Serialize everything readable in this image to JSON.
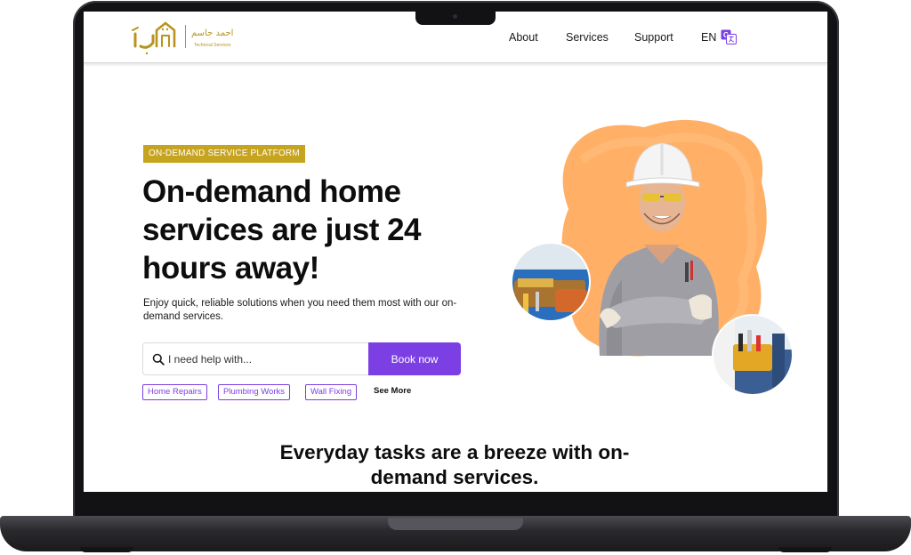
{
  "nav": {
    "logo": {
      "arabic_name": "احمد جاسم",
      "subtitle": "Technical Services"
    },
    "links": [
      {
        "label": "About"
      },
      {
        "label": "Services"
      },
      {
        "label": "Support"
      }
    ],
    "language": "EN"
  },
  "hero": {
    "badge": "ON-DEMAND SERVICE PLATFORM",
    "title": "On-demand home services are just 24 hours away!",
    "subtitle": "Enjoy quick, reliable solutions when you need them most with our on-demand services.",
    "search": {
      "placeholder": "I need help with...",
      "button": "Book now"
    },
    "tags": [
      {
        "label": "Home Repairs"
      },
      {
        "label": "Plumbing Works"
      },
      {
        "label": "Wall Fixing"
      }
    ],
    "see_more": "See More"
  },
  "section": {
    "heading": "Everyday tasks are a breeze with on-demand services."
  },
  "colors": {
    "accent_purple": "#7b3fe4",
    "badge_gold": "#c7a41f",
    "splash_orange": "#ffb066"
  }
}
